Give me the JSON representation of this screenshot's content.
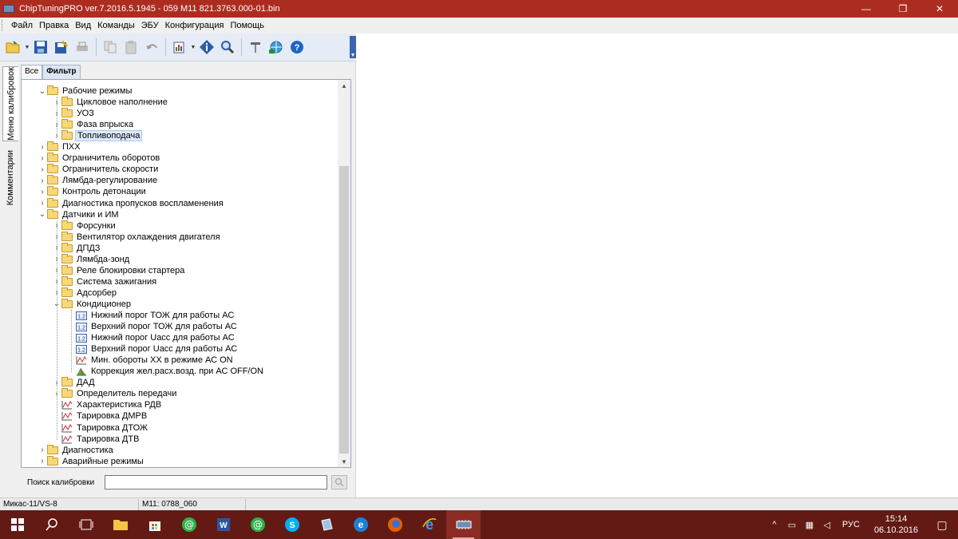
{
  "window": {
    "title": "ChipTuningPRO ver.7.2016.5.1945 - 059 M11 821.3763.000-01.bin",
    "minimize_glyph": "—",
    "maximize_glyph": "❐",
    "close_glyph": "✕"
  },
  "menu": [
    "Файл",
    "Правка",
    "Вид",
    "Команды",
    "ЭБУ",
    "Конфигурация",
    "Помощь"
  ],
  "side_tabs": {
    "calibrations_menu": "Меню калибровок",
    "comments": "Комментарии"
  },
  "panel_tabs": [
    "Все",
    "Фильтр"
  ],
  "tree": [
    {
      "level": 1,
      "expander": "open",
      "icon": "folder-icon",
      "label": "Рабочие режимы"
    },
    {
      "level": 2,
      "expander": "closed",
      "icon": "folder-icon",
      "label": "Цикловое наполнение"
    },
    {
      "level": 2,
      "expander": "closed",
      "icon": "folder-icon",
      "label": "УОЗ"
    },
    {
      "level": 2,
      "expander": "closed",
      "icon": "folder-icon",
      "label": "Фаза впрыска"
    },
    {
      "level": 2,
      "expander": "closed",
      "icon": "folder-icon",
      "label": "Топливоподача",
      "selected": true
    },
    {
      "level": 1,
      "expander": "closed",
      "icon": "folder-icon",
      "label": "ПХХ"
    },
    {
      "level": 1,
      "expander": "closed",
      "icon": "folder-icon",
      "label": "Ограничитель оборотов"
    },
    {
      "level": 1,
      "expander": "closed",
      "icon": "folder-icon",
      "label": "Ограничитель скорости"
    },
    {
      "level": 1,
      "expander": "closed",
      "icon": "folder-icon",
      "label": "Лямбда-регулирование"
    },
    {
      "level": 1,
      "expander": "closed",
      "icon": "folder-icon",
      "label": "Контроль детонации"
    },
    {
      "level": 1,
      "expander": "closed",
      "icon": "folder-icon",
      "label": "Диагностика пропусков воспламенения"
    },
    {
      "level": 1,
      "expander": "open",
      "icon": "folder-icon",
      "label": "Датчики и ИМ"
    },
    {
      "level": 2,
      "expander": "closed",
      "icon": "folder-icon",
      "label": "Форсунки"
    },
    {
      "level": 2,
      "expander": "closed",
      "icon": "folder-icon",
      "label": "Вентилятор охлаждения двигателя"
    },
    {
      "level": 2,
      "expander": "closed",
      "icon": "folder-icon",
      "label": "ДПДЗ"
    },
    {
      "level": 2,
      "expander": "closed",
      "icon": "folder-icon",
      "label": "Лямбда-зонд"
    },
    {
      "level": 2,
      "expander": "closed",
      "icon": "folder-icon",
      "label": "Реле блокировки стартера"
    },
    {
      "level": 2,
      "expander": "closed",
      "icon": "folder-icon",
      "label": "Система зажигания"
    },
    {
      "level": 2,
      "expander": "closed",
      "icon": "folder-icon",
      "label": "Адсорбер"
    },
    {
      "level": 2,
      "expander": "open",
      "icon": "folder-icon",
      "label": "Кондиционер"
    },
    {
      "level": 3,
      "expander": "none",
      "icon": "constant-icon",
      "label": "Нижний порог ТОЖ для работы АС"
    },
    {
      "level": 3,
      "expander": "none",
      "icon": "constant-icon",
      "label": "Верхний порог ТОЖ для работы АС"
    },
    {
      "level": 3,
      "expander": "none",
      "icon": "constant-icon",
      "label": "Нижний порог Uacc для работы АС"
    },
    {
      "level": 3,
      "expander": "none",
      "icon": "constant-icon",
      "label": "Верхний порог Uacc для работы АС"
    },
    {
      "level": 3,
      "expander": "none",
      "icon": "curve-icon",
      "label": "Мин. обороты ХХ в режиме АС ON"
    },
    {
      "level": 3,
      "expander": "none",
      "icon": "map3d-icon",
      "label": "Коррекция жел.расх.возд. при АС OFF/ON"
    },
    {
      "level": 2,
      "expander": "closed",
      "icon": "folder-icon",
      "label": "ДАД"
    },
    {
      "level": 2,
      "expander": "closed",
      "icon": "folder-icon",
      "label": "Определитель передачи"
    },
    {
      "level": 2,
      "expander": "none",
      "icon": "curve-icon",
      "label": "Характеристика РДВ"
    },
    {
      "level": 2,
      "expander": "none",
      "icon": "curve-icon",
      "label": "Тарировка ДМРВ"
    },
    {
      "level": 2,
      "expander": "none",
      "icon": "curve-icon",
      "label": "Тарировка ДТОЖ"
    },
    {
      "level": 2,
      "expander": "none",
      "icon": "curve-icon",
      "label": "Тарировка ДТВ"
    },
    {
      "level": 1,
      "expander": "closed",
      "icon": "folder-icon",
      "label": "Диагностика"
    },
    {
      "level": 1,
      "expander": "closed",
      "icon": "folder-icon",
      "label": "Аварийные режимы"
    }
  ],
  "search": {
    "label": "Поиск калибровки",
    "value": ""
  },
  "status": {
    "left": "Микас-11/VS-8",
    "middle": "M11: 0788_060"
  },
  "taskbar": {
    "language": "РУС",
    "time": "15:14",
    "date": "06.10.2016"
  },
  "colors": {
    "titlebar": "#ad2c20",
    "taskbar": "#631a14",
    "folder": "#f7d879",
    "selection": "#dceafa"
  }
}
